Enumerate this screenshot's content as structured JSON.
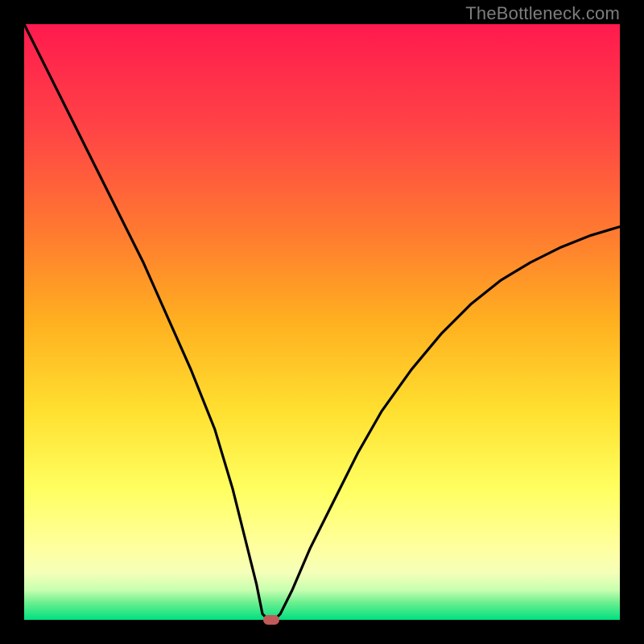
{
  "watermark": {
    "text": "TheBottleneck.com"
  },
  "colors": {
    "frame": "#000000",
    "gradient_stops": [
      "#ff1a4e",
      "#ff4545",
      "#ff7a30",
      "#ffb020",
      "#ffe030",
      "#ffff60",
      "#ffffa0",
      "#f5ffb8",
      "#c8ffb0",
      "#70f090",
      "#00e080"
    ],
    "curve": "#000000",
    "marker": "#c25a5a"
  },
  "chart_data": {
    "type": "line",
    "title": "",
    "xlabel": "",
    "ylabel": "",
    "xlim": [
      0,
      100
    ],
    "ylim": [
      0,
      100
    ],
    "series": [
      {
        "name": "bottleneck-curve",
        "x": [
          0,
          4,
          8,
          12,
          16,
          20,
          24,
          28,
          32,
          35,
          37,
          39,
          40,
          41,
          42,
          43,
          45,
          48,
          52,
          56,
          60,
          65,
          70,
          75,
          80,
          85,
          90,
          95,
          100
        ],
        "y": [
          100,
          92,
          84,
          76,
          68,
          60,
          51,
          42,
          32,
          22,
          14,
          6,
          1,
          0,
          0,
          1,
          5,
          12,
          20,
          28,
          35,
          42,
          48,
          53,
          57,
          60,
          62.5,
          64.5,
          66
        ]
      }
    ],
    "marker": {
      "x": 41.5,
      "y": 0,
      "label": "optimal-point"
    }
  }
}
